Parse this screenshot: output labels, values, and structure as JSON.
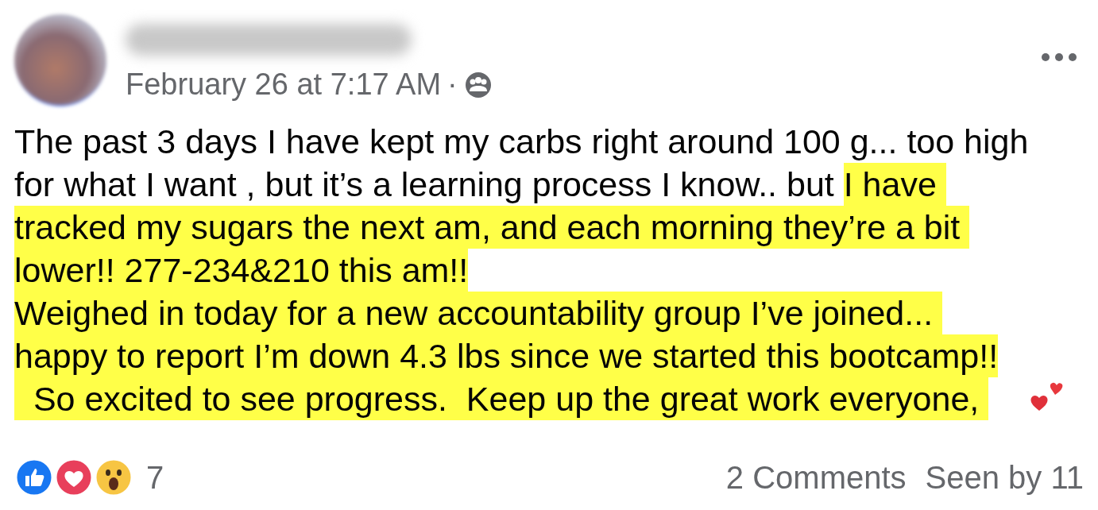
{
  "post": {
    "timestamp": "February 26 at 7:17 AM",
    "separator": "·",
    "lines": [
      [
        {
          "text": "The past 3 days I have kept my carbs right around 100 g... too high",
          "highlighted": false
        }
      ],
      [
        {
          "text": "for what I want , but it’s a learning process I know.. but ",
          "highlighted": false
        },
        {
          "text": "I have ",
          "highlighted": true
        }
      ],
      [
        {
          "text": "tracked my sugars the next am, and each morning they’re a bit ",
          "highlighted": true
        }
      ],
      [
        {
          "text": "lower!! 277-234&210 this am!!",
          "highlighted": true
        }
      ],
      [
        {
          "text": "Weighed in today for a new accountability group I’ve joined... ",
          "highlighted": true
        }
      ],
      [
        {
          "text": "happy to report I’m down 4.3 lbs since we started this bootcamp!!",
          "highlighted": true
        }
      ],
      [
        {
          "text": "  So excited to see progress.  Keep up the great work everyone, ",
          "highlighted": true
        }
      ]
    ],
    "reactions": [
      {
        "kind": "like"
      },
      {
        "kind": "love"
      },
      {
        "kind": "wow"
      }
    ],
    "reaction_count": "7",
    "comments": "2 Comments",
    "seen_by": "Seen by 11"
  }
}
